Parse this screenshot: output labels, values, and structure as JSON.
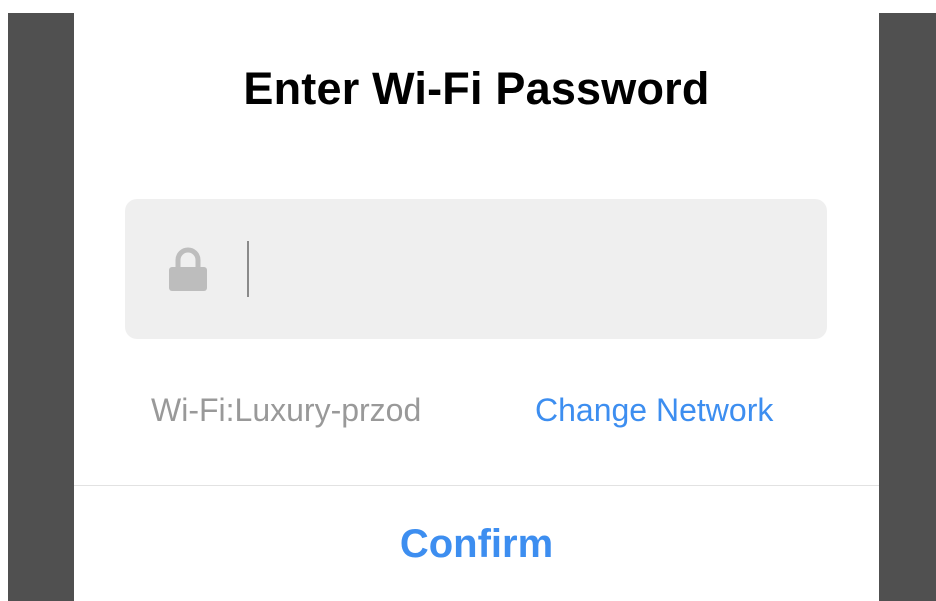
{
  "dialog": {
    "title": "Enter Wi-Fi Password",
    "password_field": {
      "value": "",
      "placeholder": "",
      "icon": "lock-icon"
    },
    "wifi_label": "Wi-Fi:Luxury-przod",
    "change_network_label": "Change Network",
    "confirm_label": "Confirm"
  },
  "colors": {
    "accent": "#3d8ef0",
    "backdrop": "#505050",
    "field_background": "#efefef",
    "secondary_text": "#999999",
    "icon": "#bdbdbd"
  }
}
